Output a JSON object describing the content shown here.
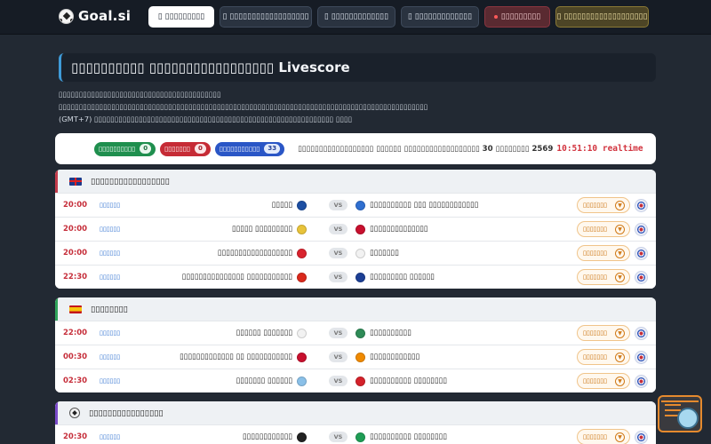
{
  "header": {
    "logo_text": "Goal.si",
    "nav": [
      {
        "label": "▯ ▯▯▯▯▯▯▯▯▯",
        "style": "active"
      },
      {
        "label": "▯ ▯▯▯▯▯▯▯▯▯▯▯▯▯▯▯▯▯▯",
        "style": "normal"
      },
      {
        "label": "▯ ▯▯▯▯▯▯▯▯▯▯▯▯▯",
        "style": "normal"
      },
      {
        "label": "▯ ▯▯▯▯▯▯▯▯▯▯▯▯▯",
        "style": "normal"
      },
      {
        "label": "▯▯▯▯▯▯▯▯▯",
        "style": "live"
      },
      {
        "label": "▯ ▯▯▯▯▯▯▯▯▯▯▯▯▯▯▯▯▯▯▯",
        "style": "gold"
      }
    ]
  },
  "page": {
    "title": "▯▯▯▯▯▯▯▯▯▯ ▯▯▯▯▯▯▯▯▯▯▯▯▯▯▯▯▯ Livescore",
    "description": "▯▯▯▯▯▯▯▯▯▯▯▯▯▯▯▯▯▯▯▯▯▯▯▯▯▯▯▯▯▯▯▯▯▯▯▯▯▯▯▯ ▯▯▯▯▯▯▯▯▯▯▯▯▯▯▯▯▯▯▯▯▯▯▯▯▯▯▯▯▯▯▯▯▯▯▯▯▯▯▯▯▯▯▯▯▯▯▯▯▯▯▯▯▯▯▯▯▯▯▯▯▯▯▯▯▯▯▯▯▯▯▯▯▯▯▯▯▯▯▯▯▯▯▯▯▯▯▯▯▯▯▯ (GMT+7) ▯▯▯▯▯▯▯▯▯▯▯▯▯▯▯▯▯▯▯▯▯▯▯▯▯▯▯▯▯▯▯▯▯▯▯▯▯▯▯▯▯▯▯▯▯▯▯▯▯▯▯▯▯▯▯▯▯▯▯ ▯▯▯▯"
  },
  "stats": {
    "pills": [
      {
        "label": "▯▯▯▯▯▯▯▯▯▯",
        "count": "0",
        "color": "#1f8f4e"
      },
      {
        "label": "▯▯▯▯▯▯▯",
        "count": "0",
        "color": "#c62b35"
      },
      {
        "label": "▯▯▯▯▯▯▯▯▯▯▯",
        "count": "33",
        "color": "#2a56c6"
      }
    ],
    "date_text": "▯▯▯▯▯▯▯▯▯▯▯▯▯▯▯▯▯▯ ▯▯▯▯▯▯ ▯▯▯▯▯▯▯▯▯▯▯▯▯▯▯▯▯▯ 30 ▯▯▯▯▯▯▯▯ 2569",
    "clock": "10:51:10 realtime"
  },
  "leagues": [
    {
      "name": "▯▯▯▯▯▯▯▯▯▯▯▯▯▯▯▯▯",
      "flag": "gb",
      "matches": [
        {
          "time": "20:00",
          "status": "▯▯▯▯▯▯",
          "home": "▯▯▯▯▯",
          "home_color": "#1d4fa3",
          "away": "▯▯▯▯▯▯▯▯▯▯ ▯▯▯ ▯▯▯▯▯▯▯▯▯▯▯▯",
          "away_color": "#2f6fd0",
          "vs": "VS",
          "detail": "▯▯▯▯▯▯▯"
        },
        {
          "time": "20:00",
          "status": "▯▯▯▯▯▯",
          "home": "▯▯▯▯▯ ▯▯▯▯▯▯▯▯▯",
          "home_color": "#e8c33a",
          "away": "▯▯▯▯▯▯▯▯▯▯▯▯▯▯",
          "away_color": "#c8102e",
          "vs": "VS",
          "detail": "▯▯▯▯▯▯▯"
        },
        {
          "time": "20:00",
          "status": "▯▯▯▯▯▯",
          "home": "▯▯▯▯▯▯▯▯▯▯▯▯▯▯▯▯▯▯",
          "home_color": "#d9232e",
          "away": "▯▯▯▯▯▯▯",
          "away_color": "#f2f2f2",
          "vs": "VS",
          "detail": "▯▯▯▯▯▯▯"
        },
        {
          "time": "22:30",
          "status": "▯▯▯▯▯▯",
          "home": "▯▯▯▯▯▯▯▯▯▯▯▯▯▯▯ ▯▯▯▯▯▯▯▯▯▯▯",
          "home_color": "#da291c",
          "away": "▯▯▯▯▯▯▯▯▯ ▯▯▯▯▯▯",
          "away_color": "#1c3f95",
          "vs": "VS",
          "detail": "▯▯▯▯▯▯▯"
        }
      ]
    },
    {
      "name": "▯▯▯▯▯▯▯▯",
      "flag": "es",
      "matches": [
        {
          "time": "22:00",
          "status": "▯▯▯▯▯▯",
          "home": "▯▯▯▯▯▯ ▯▯▯▯▯▯▯",
          "home_color": "#f2f2f2",
          "away": "▯▯▯▯▯▯▯▯▯▯",
          "away_color": "#2e8b57",
          "vs": "VS",
          "detail": "▯▯▯▯▯▯▯"
        },
        {
          "time": "00:30",
          "status": "▯▯▯▯▯▯",
          "home": "▯▯▯▯▯▯▯▯▯▯▯▯▯ ▯▯ ▯▯▯▯▯▯▯▯▯▯▯",
          "home_color": "#c8102e",
          "away": "▯▯▯▯▯▯▯▯▯▯▯▯",
          "away_color": "#f08a00",
          "vs": "VS",
          "detail": "▯▯▯▯▯▯▯"
        },
        {
          "time": "02:30",
          "status": "▯▯▯▯▯▯",
          "home": "▯▯▯▯▯▯▯ ▯▯▯▯▯▯",
          "home_color": "#8ac0e8",
          "away": "▯▯▯▯▯▯▯▯▯▯ ▯▯▯▯▯▯▯▯",
          "away_color": "#d4212a",
          "vs": "VS",
          "detail": "▯▯▯▯▯▯▯"
        }
      ]
    },
    {
      "name": "▯▯▯▯▯▯▯▯▯▯▯▯▯▯▯▯",
      "flag": "ot",
      "matches": [
        {
          "time": "20:30",
          "status": "▯▯▯▯▯▯",
          "home": "▯▯▯▯▯▯▯▯▯▯▯▯",
          "home_color": "#222222",
          "away": "▯▯▯▯▯▯▯▯▯▯ ▯▯▯▯▯▯▯▯",
          "away_color": "#1f9d55",
          "vs": "VS",
          "detail": "▯▯▯▯▯▯▯"
        }
      ]
    }
  ]
}
